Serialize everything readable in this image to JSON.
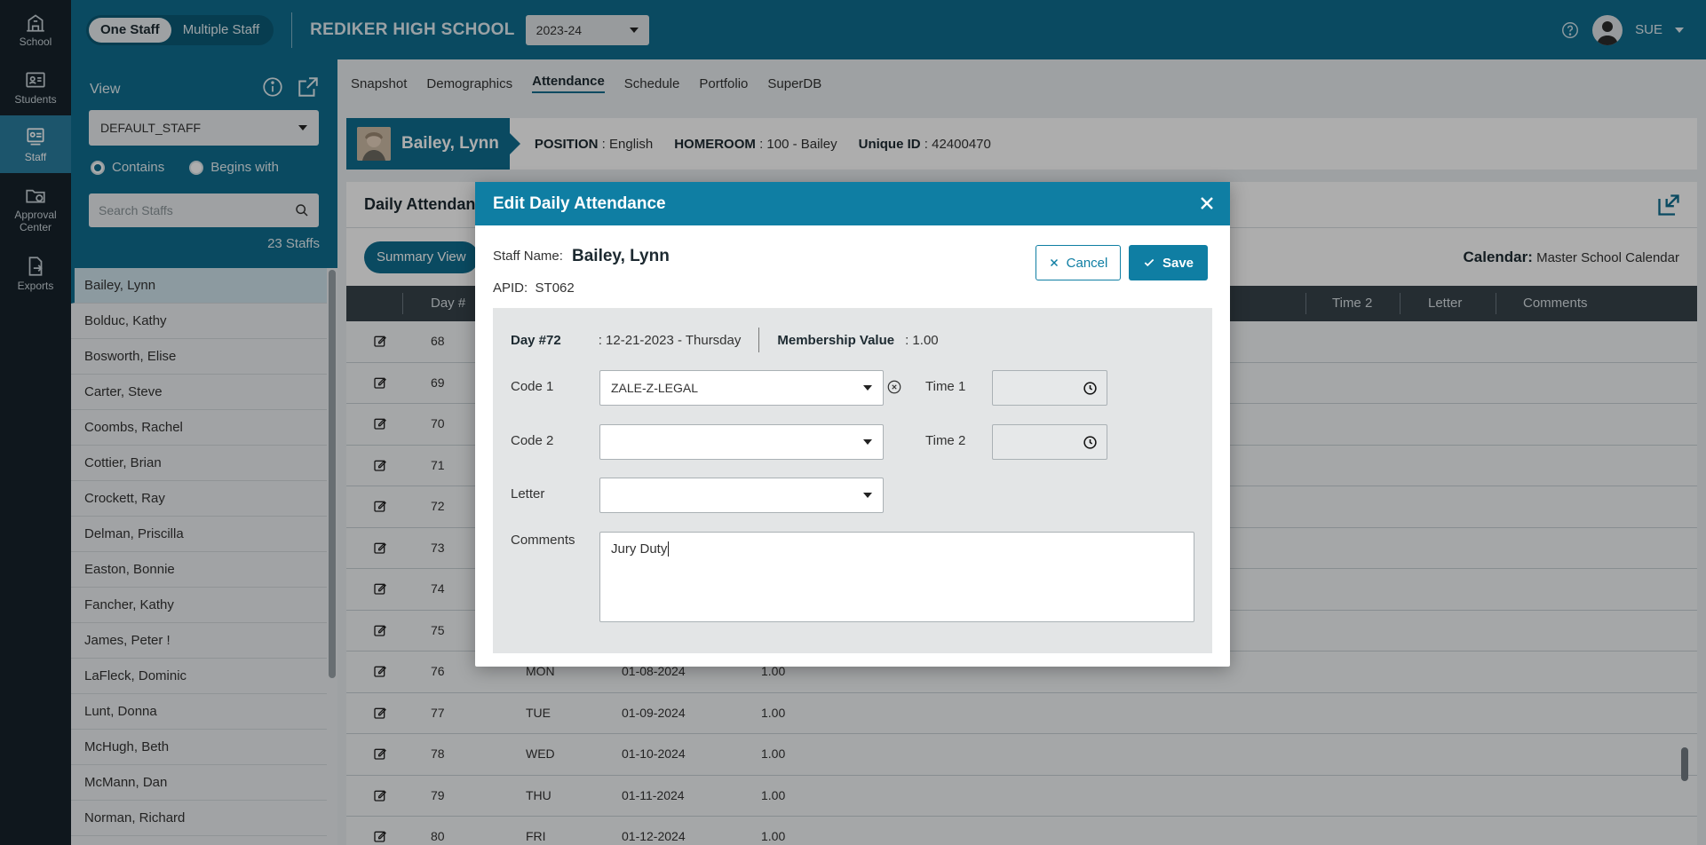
{
  "rail": [
    {
      "label": "School",
      "icon": "school-icon"
    },
    {
      "label": "Students",
      "icon": "students-icon"
    },
    {
      "label": "Staff",
      "icon": "staff-icon"
    },
    {
      "label": "Approval Center",
      "icon": "approval-folder-icon"
    },
    {
      "label": "Exports",
      "icon": "exports-icon"
    }
  ],
  "topbar": {
    "toggle_one": "One Staff",
    "toggle_multiple": "Multiple Staff",
    "school": "REDIKER HIGH SCHOOL",
    "year": "2023-24",
    "user": "SUE"
  },
  "sidebar": {
    "view_label": "View",
    "view_value": "DEFAULT_STAFF",
    "radio_contains": "Contains",
    "radio_begins": "Begins with",
    "search_placeholder": "Search Staffs",
    "count": "23 Staffs",
    "staff": [
      "Bailey, Lynn",
      "Bolduc, Kathy",
      "Bosworth, Elise",
      "Carter, Steve",
      "Coombs, Rachel",
      "Cottier, Brian",
      "Crockett, Ray",
      "Delman, Priscilla",
      "Easton, Bonnie",
      "Fancher, Kathy",
      "James, Peter !",
      "LaFleck, Dominic",
      "Lunt, Donna",
      "McHugh, Beth",
      "McMann, Dan",
      "Norman, Richard"
    ]
  },
  "tabs": [
    "Snapshot",
    "Demographics",
    "Attendance",
    "Schedule",
    "Portfolio",
    "SuperDB"
  ],
  "banner": {
    "name": "Bailey, Lynn",
    "position_label": "POSITION",
    "position": ": English",
    "homeroom_label": "HOMEROOM",
    "homeroom": ": 100 - Bailey",
    "uid_label": "Unique ID",
    "uid": ": 42400470"
  },
  "panel": {
    "title": "Daily Attendance",
    "summary_btn": "Summary View",
    "calendar_label": "Calendar:",
    "calendar_value": "Master School Calendar",
    "cols": {
      "day": "Day #",
      "time2": "Time 2",
      "letter": "Letter",
      "comments": "Comments"
    },
    "rows": [
      {
        "day": "68",
        "dow": "",
        "date": "",
        "val": ""
      },
      {
        "day": "69",
        "dow": "",
        "date": "",
        "val": ""
      },
      {
        "day": "70",
        "dow": "",
        "date": "",
        "val": ""
      },
      {
        "day": "71",
        "dow": "",
        "date": "",
        "val": ""
      },
      {
        "day": "72",
        "dow": "",
        "date": "",
        "val": ""
      },
      {
        "day": "73",
        "dow": "",
        "date": "",
        "val": ""
      },
      {
        "day": "74",
        "dow": "",
        "date": "",
        "val": ""
      },
      {
        "day": "75",
        "dow": "",
        "date": "",
        "val": ""
      },
      {
        "day": "76",
        "dow": "MON",
        "date": "01-08-2024",
        "val": "1.00"
      },
      {
        "day": "77",
        "dow": "TUE",
        "date": "01-09-2024",
        "val": "1.00"
      },
      {
        "day": "78",
        "dow": "WED",
        "date": "01-10-2024",
        "val": "1.00"
      },
      {
        "day": "79",
        "dow": "THU",
        "date": "01-11-2024",
        "val": "1.00"
      },
      {
        "day": "80",
        "dow": "FRI",
        "date": "01-12-2024",
        "val": "1.00"
      }
    ]
  },
  "modal": {
    "title": "Edit Daily Attendance",
    "staff_label": "Staff Name:",
    "staff_name": "Bailey, Lynn",
    "apid_label": "APID:",
    "apid": "ST062",
    "cancel": "Cancel",
    "save": "Save",
    "day": "Day #72",
    "date": ": 12-21-2023 - Thursday",
    "membership_label": "Membership Value",
    "membership": ": 1.00",
    "code1_label": "Code 1",
    "code1": "ZALE-Z-LEGAL",
    "code2_label": "Code 2",
    "code2": "",
    "letter_label": "Letter",
    "letter": "",
    "time1_label": "Time 1",
    "time2_label": "Time 2",
    "comments_label": "Comments",
    "comments": "Jury Duty"
  },
  "colors": {
    "primary": "#0f6e8f",
    "modal_header": "#0f7ea3",
    "rail": "#17232b"
  }
}
